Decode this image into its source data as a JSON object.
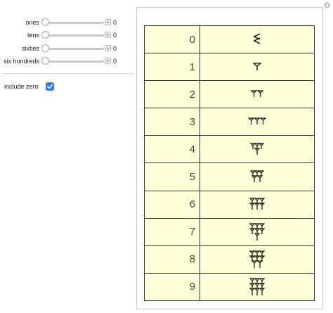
{
  "sliders": [
    {
      "label": "ones",
      "value": "0"
    },
    {
      "label": "tens",
      "value": "0"
    },
    {
      "label": "sixties",
      "value": "0"
    },
    {
      "label": "six hundreds",
      "value": "0"
    }
  ],
  "include_zero": {
    "label": "include zero",
    "checked": true
  },
  "table": {
    "rows": [
      {
        "number": "0",
        "glyph": "zero"
      },
      {
        "number": "1",
        "glyph": "one"
      },
      {
        "number": "2",
        "glyph": "two"
      },
      {
        "number": "3",
        "glyph": "three"
      },
      {
        "number": "4",
        "glyph": "four"
      },
      {
        "number": "5",
        "glyph": "five"
      },
      {
        "number": "6",
        "glyph": "six"
      },
      {
        "number": "7",
        "glyph": "seven"
      },
      {
        "number": "8",
        "glyph": "eight"
      },
      {
        "number": "9",
        "glyph": "nine"
      }
    ]
  },
  "colors": {
    "table_bg": "#ffffd8",
    "checkbox": "#2f7de1"
  }
}
